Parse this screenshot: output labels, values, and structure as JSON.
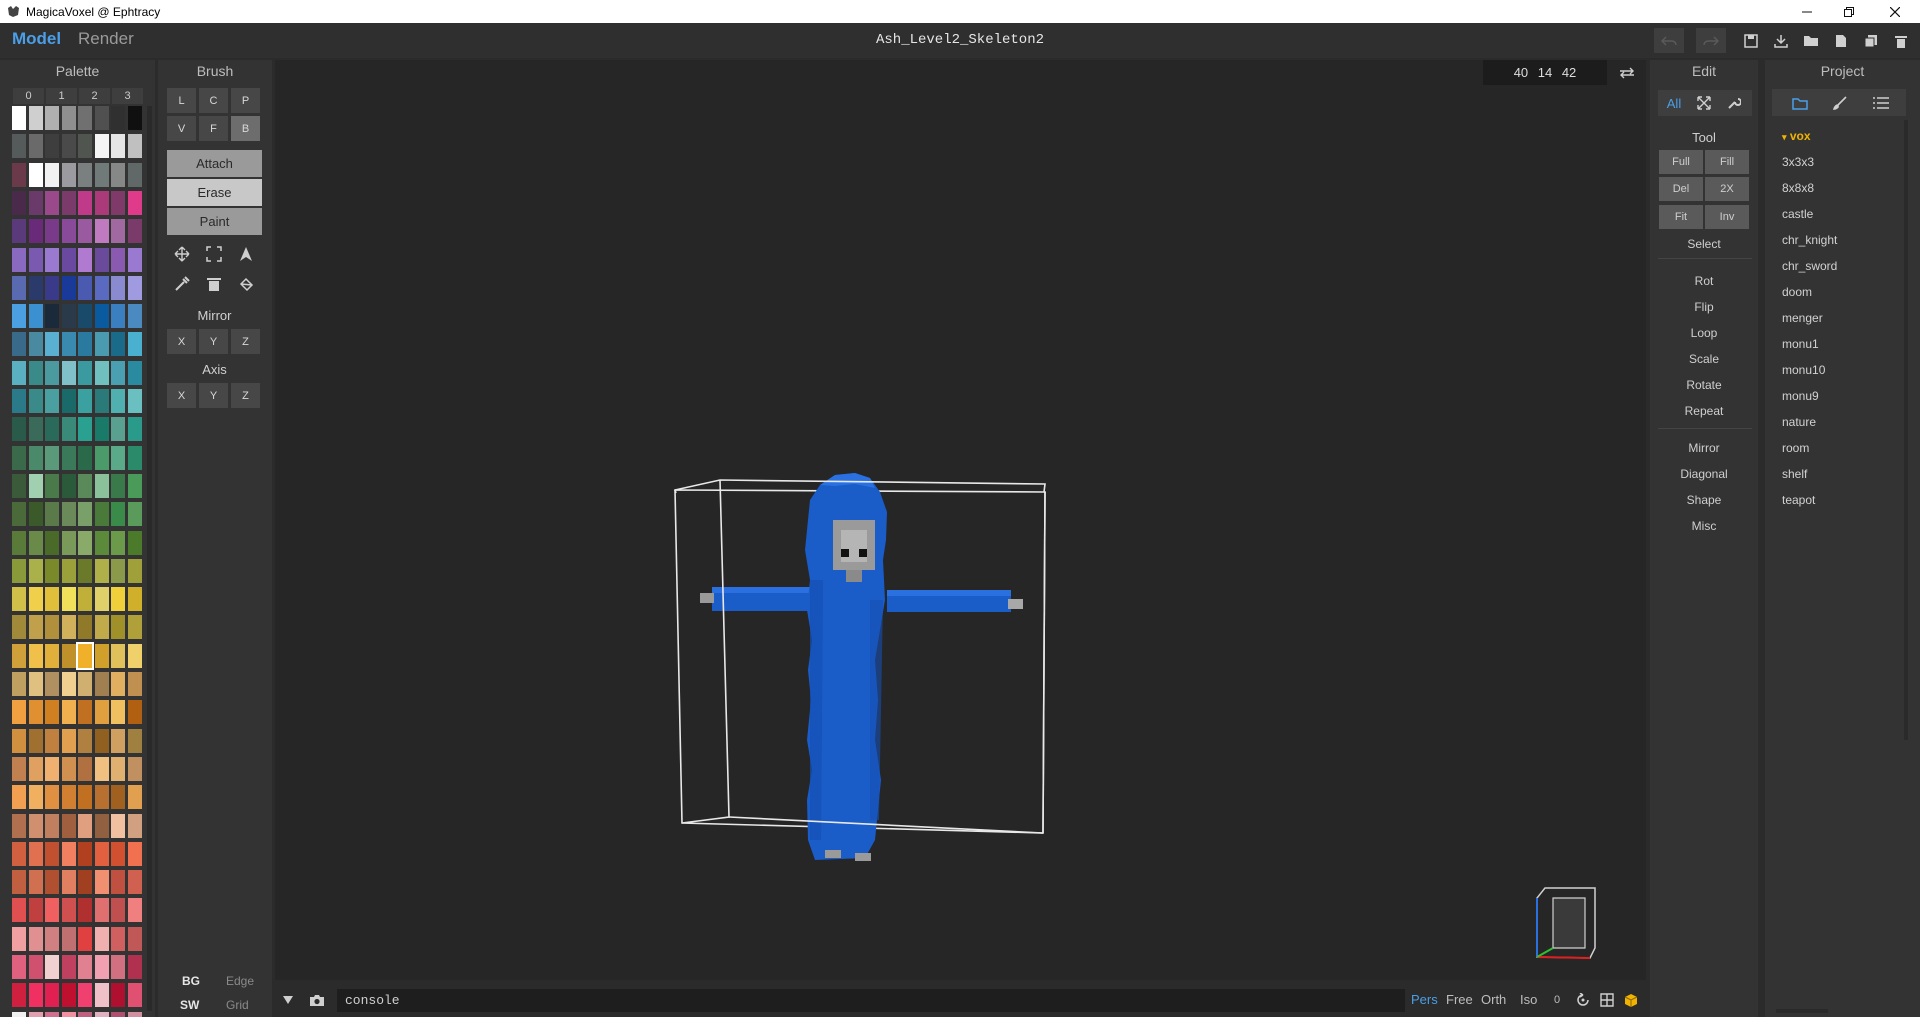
{
  "window": {
    "title": "MagicaVoxel @ Ephtracy",
    "controls": [
      "minimize",
      "maximize",
      "close"
    ]
  },
  "header": {
    "modes": [
      {
        "label": "Model",
        "active": true
      },
      {
        "label": "Render",
        "active": false
      }
    ],
    "document_title": "Ash_Level2_Skeleton2",
    "toolbar_icons": [
      "undo-icon",
      "redo-icon",
      "save-icon",
      "import-icon",
      "open-icon",
      "new-icon",
      "duplicate-icon",
      "delete-icon"
    ]
  },
  "palette": {
    "title": "Palette",
    "pages": [
      "0",
      "1",
      "2",
      "3"
    ],
    "selected_index": 156,
    "colors": [
      "#ffffff",
      "#cfcfcf",
      "#b0b0b0",
      "#8f8f8f",
      "#707070",
      "#505050",
      "#303030",
      "#101010",
      "#555a5a",
      "#6a6a6a",
      "#3e3e3e",
      "#4a4a4a",
      "#505550",
      "#f5f5f5",
      "#e6e6e6",
      "#c0c0c0",
      "#6a3a4a",
      "#ffffff",
      "#f2f2f2",
      "#9a9aa0",
      "#7a8080",
      "#707a78",
      "#868888",
      "#606868",
      "#4a2a4a",
      "#6a3a6a",
      "#9a4a8a",
      "#7a3a6a",
      "#c03a8a",
      "#aa3a7a",
      "#803a6a",
      "#e03a8a",
      "#5a3a7a",
      "#6a2a7a",
      "#7a3a8a",
      "#8a4a9a",
      "#9a5aa0",
      "#c07ac0",
      "#a06aa0",
      "#7a3a6a",
      "#8a6ac0",
      "#7a5ab0",
      "#9a7ad0",
      "#6a4aa0",
      "#b07ad0",
      "#6a4a9a",
      "#8a5ab0",
      "#9a7ad0",
      "#5a6ab0",
      "#2a3a6a",
      "#3a3a8a",
      "#1a3a9a",
      "#4a5ab0",
      "#5a6ac0",
      "#8a8ad0",
      "#a09ae0",
      "#4aa0e0",
      "#3a90d0",
      "#1a2a3a",
      "#2a3a4a",
      "#1a4a6a",
      "#0a5aa0",
      "#3a80c0",
      "#4a8ac0",
      "#3a6a8a",
      "#4a8aa0",
      "#5ab0d0",
      "#3a8ab0",
      "#2a7aa0",
      "#4a9ab0",
      "#1a6a8a",
      "#4ab0d0",
      "#5ab0c0",
      "#3a8a8a",
      "#4a9aa0",
      "#80c0c8",
      "#3a9aa0",
      "#70c0c0",
      "#4aa0b0",
      "#2a8aa0",
      "#2a7a8a",
      "#3a8a8a",
      "#4aa0a0",
      "#1a6a6a",
      "#3aa0a0",
      "#2a7a7a",
      "#50b0b0",
      "#6ac0c0",
      "#2a5a4a",
      "#3a6a5a",
      "#2a6a5a",
      "#3a8a7a",
      "#2aa090",
      "#1a7a6a",
      "#5aa090",
      "#2a9a8a",
      "#3a6a4a",
      "#4a8a6a",
      "#5a9a7a",
      "#3a7a5a",
      "#2a6a4a",
      "#4a9a6a",
      "#5aaa8a",
      "#2a8a6a",
      "#3a5a3a",
      "#a0d0b0",
      "#4a7a4a",
      "#2a5a3a",
      "#5a8a5a",
      "#8ac09a",
      "#3a7a4a",
      "#4a9a5a",
      "#4a6a3a",
      "#3a5a2a",
      "#5a7a4a",
      "#6a8a5a",
      "#7aa06a",
      "#4a7a3a",
      "#3a8a4a",
      "#5a9a5a",
      "#5a7a3a",
      "#6a8a4a",
      "#4a6a2a",
      "#7a9a5a",
      "#8aaa6a",
      "#5a8a3a",
      "#6a9a4a",
      "#4a7a2a",
      "#8a9a3a",
      "#aab04a",
      "#7a8a2a",
      "#9aa03a",
      "#6a7a2a",
      "#b0b04a",
      "#8a9a4a",
      "#a0a03a",
      "#d0c04a",
      "#f0d04a",
      "#e0c03a",
      "#f0e05a",
      "#c0b03a",
      "#e0d06a",
      "#f0d03a",
      "#d0b02a",
      "#a08a3a",
      "#c0a04a",
      "#b0903a",
      "#d0b05a",
      "#907a2a",
      "#c0aa4a",
      "#a0902a",
      "#b0a03a",
      "#d0a03a",
      "#f0c04a",
      "#e0b03a",
      "#c0902a",
      "#f0b02a",
      "#d0a02a",
      "#e0c05a",
      "#f0d06a",
      "#c0a060",
      "#e0c080",
      "#b09060",
      "#f0d090",
      "#d0b070",
      "#a08050",
      "#e0b060",
      "#c09050",
      "#f0a040",
      "#e09030",
      "#d08020",
      "#f0b050",
      "#c07020",
      "#e0a040",
      "#f0c060",
      "#b06010",
      "#d09040",
      "#a07030",
      "#c08040",
      "#e0a050",
      "#b08040",
      "#906020",
      "#d0a060",
      "#a08040",
      "#c08050",
      "#e0a060",
      "#f0b070",
      "#d09050",
      "#b07040",
      "#f0c080",
      "#e0b070",
      "#c09060",
      "#f0a050",
      "#f0b060",
      "#e09040",
      "#d08030",
      "#c07020",
      "#b87030",
      "#a06020",
      "#e0a050",
      "#b07050",
      "#d09070",
      "#c08060",
      "#a06040",
      "#e0a080",
      "#906040",
      "#f0c0a0",
      "#d0a080",
      "#d06040",
      "#e07050",
      "#c05030",
      "#f08060",
      "#b04020",
      "#e06040",
      "#d05030",
      "#f07050",
      "#c06040",
      "#d07050",
      "#b05030",
      "#e08060",
      "#a04020",
      "#f09070",
      "#c05040",
      "#d06050",
      "#e05050",
      "#c04040",
      "#f06060",
      "#d05050",
      "#b03030",
      "#e07070",
      "#c05050",
      "#f08080",
      "#f0a0a0",
      "#e09090",
      "#d08080",
      "#c07070",
      "#e04040",
      "#f0b0b0",
      "#d06060",
      "#c05858",
      "#e06080",
      "#d05070",
      "#f0d0d0",
      "#c04060",
      "#e08090",
      "#f0a0b0",
      "#d07080",
      "#b03050",
      "#d02040",
      "#f03060",
      "#e02050",
      "#c01030",
      "#f04070",
      "#f0c0c8",
      "#b01030",
      "#e05070",
      "#f0f0f0",
      "#e0a0b0",
      "#d07090",
      "#f090a0",
      "#c06080",
      "#e0b0c0",
      "#b05070",
      "#d090a0"
    ]
  },
  "brush": {
    "title": "Brush",
    "row1": [
      {
        "label": "L",
        "active": false
      },
      {
        "label": "C",
        "active": false
      },
      {
        "label": "P",
        "active": false
      }
    ],
    "row2": [
      {
        "label": "V",
        "active": false
      },
      {
        "label": "F",
        "active": false
      },
      {
        "label": "B",
        "active": true
      }
    ],
    "modes": [
      {
        "label": "Attach",
        "selected": false
      },
      {
        "label": "Erase",
        "selected": true
      },
      {
        "label": "Paint",
        "selected": false
      }
    ],
    "tool_icons": [
      "move-icon",
      "select-marquee-icon",
      "pointer-icon",
      "eyedropper-icon",
      "trash-icon",
      "bucket-icon"
    ],
    "mirror_label": "Mirror",
    "mirror": [
      "X",
      "Y",
      "Z"
    ],
    "axis_label": "Axis",
    "axis": [
      "X",
      "Y",
      "Z"
    ],
    "bottom": {
      "bg": "BG",
      "edge": "Edge",
      "sw": "SW",
      "grid": "Grid"
    }
  },
  "viewport": {
    "coords": "40 14 42",
    "console_placeholder": "console",
    "views": [
      {
        "label": "Pers",
        "active": true
      },
      {
        "label": "Free",
        "active": false
      },
      {
        "label": "Orth",
        "active": false
      },
      {
        "label": "Iso",
        "active": false
      }
    ],
    "zoom_value": "0",
    "model_colors": {
      "body": "#1a5cc8",
      "bone": "#9a9a9a",
      "box": "#e8e8e8"
    }
  },
  "edit": {
    "title": "Edit",
    "tabs": [
      "All"
    ],
    "tool_label": "Tool",
    "tool_buttons": [
      "Full",
      "Fill",
      "Del",
      "2X",
      "Fit",
      "Inv"
    ],
    "select_label": "Select",
    "items1": [
      "Rot",
      "Flip",
      "Loop",
      "Scale",
      "Rotate",
      "Repeat"
    ],
    "items2": [
      "Mirror",
      "Diagonal",
      "Shape",
      "Misc"
    ]
  },
  "project": {
    "title": "Project",
    "folder": "vox",
    "files": [
      "3x3x3",
      "8x8x8",
      "castle",
      "chr_knight",
      "chr_sword",
      "doom",
      "menger",
      "monu1",
      "monu10",
      "monu9",
      "nature",
      "room",
      "shelf",
      "teapot"
    ]
  }
}
